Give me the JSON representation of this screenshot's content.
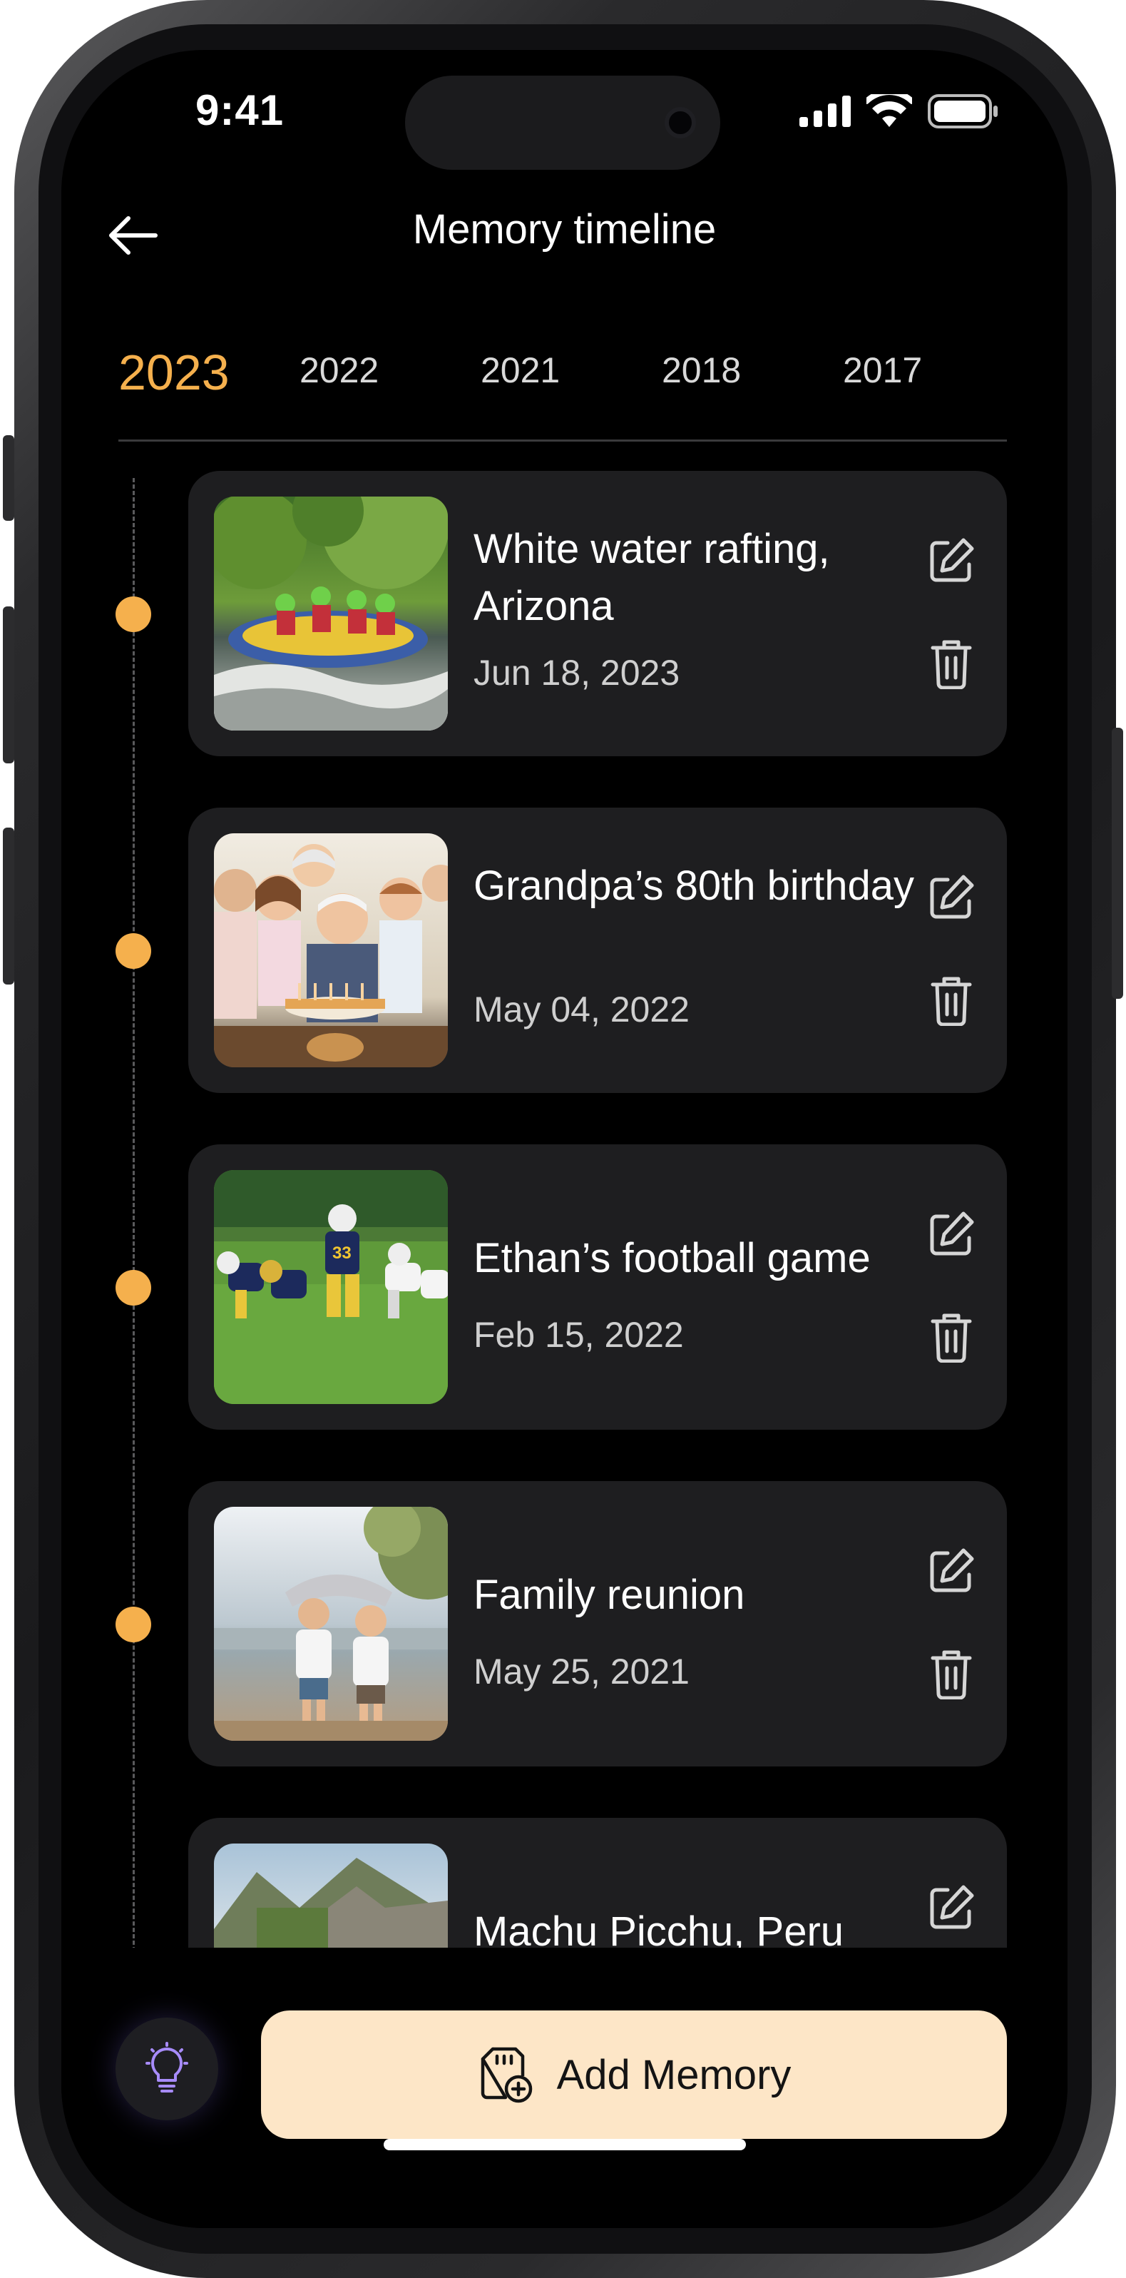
{
  "status_bar": {
    "time": "9:41"
  },
  "header": {
    "title": "Memory timeline"
  },
  "year_tabs": [
    {
      "label": "2023",
      "active": true
    },
    {
      "label": "2022",
      "active": false
    },
    {
      "label": "2021",
      "active": false
    },
    {
      "label": "2018",
      "active": false
    },
    {
      "label": "2017",
      "active": false
    }
  ],
  "memories": [
    {
      "title": "White water rafting, Arizona",
      "date": "Jun 18, 2023",
      "photo": "rafting-photo"
    },
    {
      "title": "Grandpa’s 80th birthday",
      "date": "May 04, 2022",
      "photo": "birthday-photo"
    },
    {
      "title": "Ethan’s football game",
      "date": "Feb 15, 2022",
      "photo": "football-photo"
    },
    {
      "title": "Family reunion",
      "date": "May 25, 2021",
      "photo": "beach-photo"
    },
    {
      "title": "Machu Picchu, Peru",
      "date": "",
      "photo": "ruins-photo"
    }
  ],
  "actions": {
    "add_memory_label": "Add Memory"
  },
  "icons": {
    "back": "arrow-left-icon",
    "edit": "pencil-square-icon",
    "delete": "trash-icon",
    "idea": "lightbulb-icon",
    "add": "sd-card-plus-icon"
  },
  "colors": {
    "accent": "#f5b04d",
    "card_bg": "#1e1e20",
    "add_button_bg": "#fde6c7",
    "idea_icon": "#a78bfa"
  }
}
